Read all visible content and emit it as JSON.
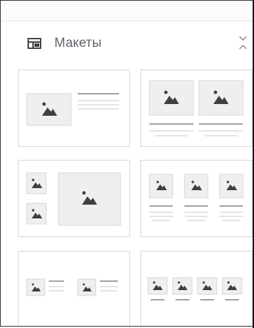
{
  "panel": {
    "title": "Макеты",
    "header_icon": "layout-icon",
    "collapse_icon": "chevron-collapse-icon"
  },
  "layouts": [
    {
      "id": "image-left-text-right",
      "icon": "image-placeholder-icon"
    },
    {
      "id": "two-images-with-captions",
      "icon": "image-placeholder-icon"
    },
    {
      "id": "two-small-images-one-large",
      "icon": "image-placeholder-icon"
    },
    {
      "id": "three-images-with-captions",
      "icon": "image-placeholder-icon"
    },
    {
      "id": "two-images-with-side-text",
      "icon": "image-placeholder-icon"
    },
    {
      "id": "four-images-with-captions",
      "icon": "image-placeholder-icon"
    }
  ],
  "colors": {
    "border": "#d6d6d6",
    "placeholder_fill": "#efefef",
    "icon": "#3c4043",
    "line": "#9e9e9e",
    "title_text": "#5f6368"
  }
}
